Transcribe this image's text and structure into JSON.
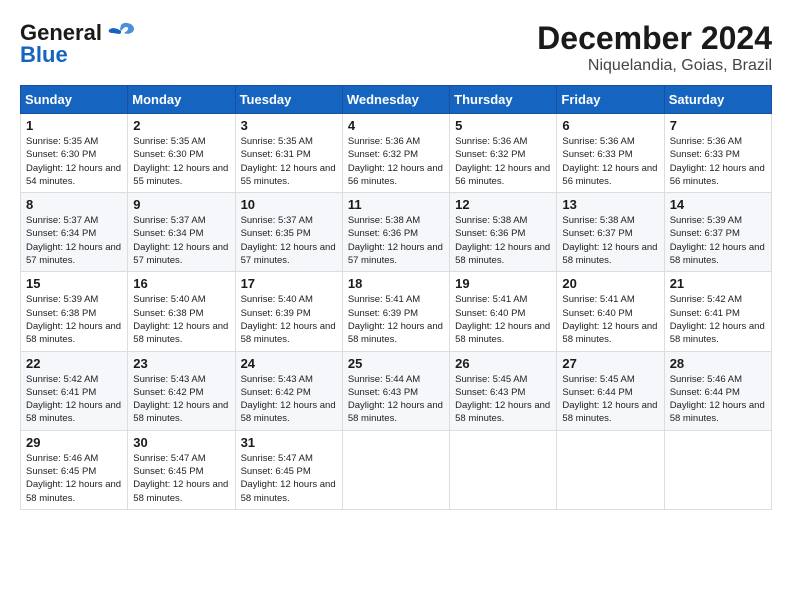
{
  "logo": {
    "line1": "General",
    "line2": "Blue"
  },
  "title": "December 2024",
  "subtitle": "Niquelandia, Goias, Brazil",
  "days_of_week": [
    "Sunday",
    "Monday",
    "Tuesday",
    "Wednesday",
    "Thursday",
    "Friday",
    "Saturday"
  ],
  "weeks": [
    [
      {
        "day": 1,
        "sunrise": "5:35 AM",
        "sunset": "6:30 PM",
        "daylight": "12 hours and 54 minutes."
      },
      {
        "day": 2,
        "sunrise": "5:35 AM",
        "sunset": "6:30 PM",
        "daylight": "12 hours and 55 minutes."
      },
      {
        "day": 3,
        "sunrise": "5:35 AM",
        "sunset": "6:31 PM",
        "daylight": "12 hours and 55 minutes."
      },
      {
        "day": 4,
        "sunrise": "5:36 AM",
        "sunset": "6:32 PM",
        "daylight": "12 hours and 56 minutes."
      },
      {
        "day": 5,
        "sunrise": "5:36 AM",
        "sunset": "6:32 PM",
        "daylight": "12 hours and 56 minutes."
      },
      {
        "day": 6,
        "sunrise": "5:36 AM",
        "sunset": "6:33 PM",
        "daylight": "12 hours and 56 minutes."
      },
      {
        "day": 7,
        "sunrise": "5:36 AM",
        "sunset": "6:33 PM",
        "daylight": "12 hours and 56 minutes."
      }
    ],
    [
      {
        "day": 8,
        "sunrise": "5:37 AM",
        "sunset": "6:34 PM",
        "daylight": "12 hours and 57 minutes."
      },
      {
        "day": 9,
        "sunrise": "5:37 AM",
        "sunset": "6:34 PM",
        "daylight": "12 hours and 57 minutes."
      },
      {
        "day": 10,
        "sunrise": "5:37 AM",
        "sunset": "6:35 PM",
        "daylight": "12 hours and 57 minutes."
      },
      {
        "day": 11,
        "sunrise": "5:38 AM",
        "sunset": "6:36 PM",
        "daylight": "12 hours and 57 minutes."
      },
      {
        "day": 12,
        "sunrise": "5:38 AM",
        "sunset": "6:36 PM",
        "daylight": "12 hours and 58 minutes."
      },
      {
        "day": 13,
        "sunrise": "5:38 AM",
        "sunset": "6:37 PM",
        "daylight": "12 hours and 58 minutes."
      },
      {
        "day": 14,
        "sunrise": "5:39 AM",
        "sunset": "6:37 PM",
        "daylight": "12 hours and 58 minutes."
      }
    ],
    [
      {
        "day": 15,
        "sunrise": "5:39 AM",
        "sunset": "6:38 PM",
        "daylight": "12 hours and 58 minutes."
      },
      {
        "day": 16,
        "sunrise": "5:40 AM",
        "sunset": "6:38 PM",
        "daylight": "12 hours and 58 minutes."
      },
      {
        "day": 17,
        "sunrise": "5:40 AM",
        "sunset": "6:39 PM",
        "daylight": "12 hours and 58 minutes."
      },
      {
        "day": 18,
        "sunrise": "5:41 AM",
        "sunset": "6:39 PM",
        "daylight": "12 hours and 58 minutes."
      },
      {
        "day": 19,
        "sunrise": "5:41 AM",
        "sunset": "6:40 PM",
        "daylight": "12 hours and 58 minutes."
      },
      {
        "day": 20,
        "sunrise": "5:41 AM",
        "sunset": "6:40 PM",
        "daylight": "12 hours and 58 minutes."
      },
      {
        "day": 21,
        "sunrise": "5:42 AM",
        "sunset": "6:41 PM",
        "daylight": "12 hours and 58 minutes."
      }
    ],
    [
      {
        "day": 22,
        "sunrise": "5:42 AM",
        "sunset": "6:41 PM",
        "daylight": "12 hours and 58 minutes."
      },
      {
        "day": 23,
        "sunrise": "5:43 AM",
        "sunset": "6:42 PM",
        "daylight": "12 hours and 58 minutes."
      },
      {
        "day": 24,
        "sunrise": "5:43 AM",
        "sunset": "6:42 PM",
        "daylight": "12 hours and 58 minutes."
      },
      {
        "day": 25,
        "sunrise": "5:44 AM",
        "sunset": "6:43 PM",
        "daylight": "12 hours and 58 minutes."
      },
      {
        "day": 26,
        "sunrise": "5:45 AM",
        "sunset": "6:43 PM",
        "daylight": "12 hours and 58 minutes."
      },
      {
        "day": 27,
        "sunrise": "5:45 AM",
        "sunset": "6:44 PM",
        "daylight": "12 hours and 58 minutes."
      },
      {
        "day": 28,
        "sunrise": "5:46 AM",
        "sunset": "6:44 PM",
        "daylight": "12 hours and 58 minutes."
      }
    ],
    [
      {
        "day": 29,
        "sunrise": "5:46 AM",
        "sunset": "6:45 PM",
        "daylight": "12 hours and 58 minutes."
      },
      {
        "day": 30,
        "sunrise": "5:47 AM",
        "sunset": "6:45 PM",
        "daylight": "12 hours and 58 minutes."
      },
      {
        "day": 31,
        "sunrise": "5:47 AM",
        "sunset": "6:45 PM",
        "daylight": "12 hours and 58 minutes."
      },
      null,
      null,
      null,
      null
    ]
  ]
}
